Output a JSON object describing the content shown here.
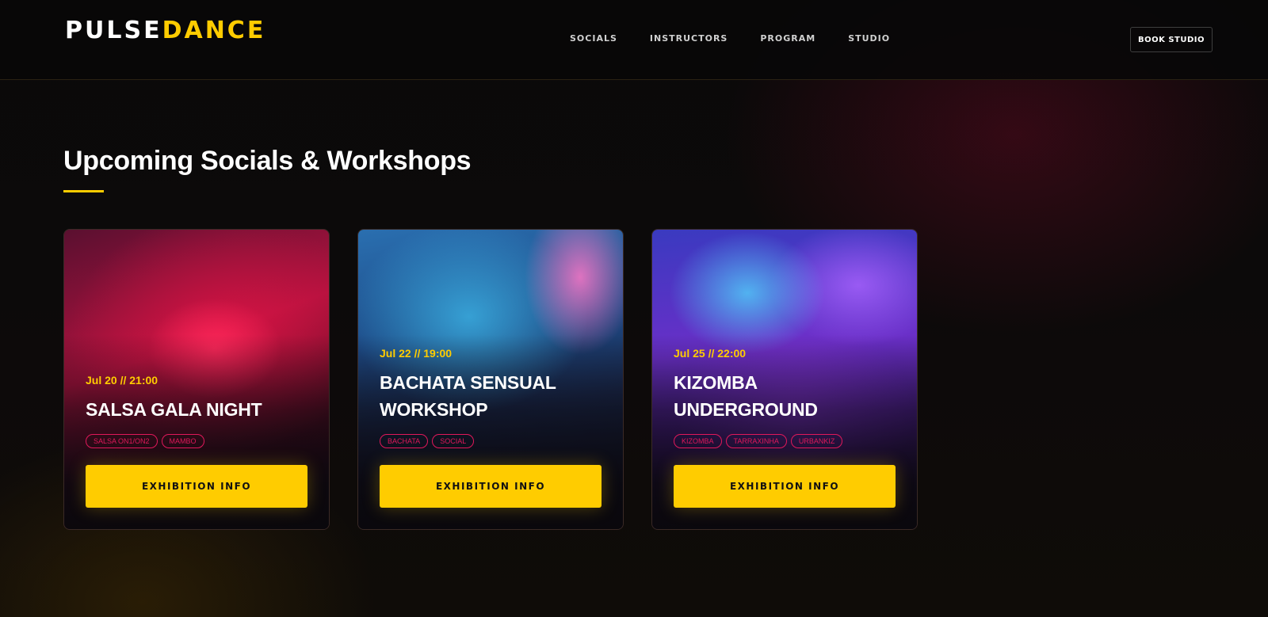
{
  "header": {
    "logo_part1": "PULSE",
    "logo_part2": "DANCE",
    "nav": [
      "SOCIALS",
      "INSTRUCTORS",
      "PROGRAM",
      "STUDIO"
    ],
    "cta_label": "BOOK STUDIO"
  },
  "section": {
    "title": "Upcoming Socials & Workshops"
  },
  "events": [
    {
      "date": "Jul 20 // 21:00",
      "name": "SALSA GALA NIGHT",
      "tags": [
        "SALSA ON1/ON2",
        "MAMBO"
      ],
      "button_label": "EXHIBITION INFO"
    },
    {
      "date": "Jul 22 // 19:00",
      "name": "BACHATA SENSUAL WORKSHOP",
      "tags": [
        "BACHATA",
        "SOCIAL"
      ],
      "button_label": "EXHIBITION INFO"
    },
    {
      "date": "Jul 25 // 22:00",
      "name": "KIZOMBA UNDERGROUND",
      "tags": [
        "KIZOMBA",
        "TARRAXINHA",
        "URBANKIZ"
      ],
      "button_label": "EXHIBITION INFO"
    }
  ],
  "colors": {
    "accent": "#ffcc00",
    "tag": "#e0185a",
    "background": "#0b0a0a"
  }
}
